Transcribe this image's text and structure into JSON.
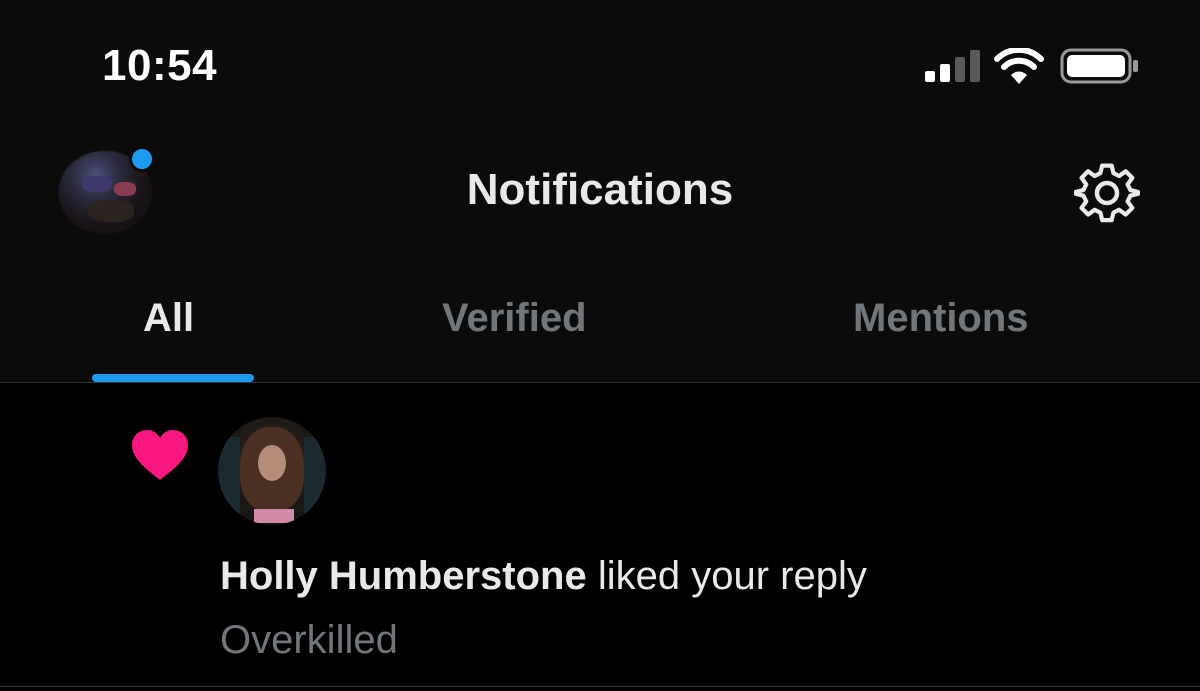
{
  "status_bar": {
    "time": "10:54",
    "signal_icon": "cellular-signal-icon",
    "wifi_icon": "wifi-icon",
    "battery_icon": "battery-icon"
  },
  "header": {
    "title": "Notifications",
    "avatar_icon": "profile-avatar",
    "settings_icon": "gear-icon"
  },
  "tabs": [
    {
      "label": "All",
      "active": true
    },
    {
      "label": "Verified",
      "active": false
    },
    {
      "label": "Mentions",
      "active": false
    }
  ],
  "notifications": [
    {
      "type_icon": "heart-icon",
      "user_name": "Holly Humberstone",
      "action": " liked your reply",
      "content": "Overkilled"
    }
  ],
  "colors": {
    "accent": "#1d9bf0",
    "like": "#f91880",
    "text_primary": "#e7e9ea",
    "text_secondary": "#71767b",
    "background": "#000000"
  }
}
